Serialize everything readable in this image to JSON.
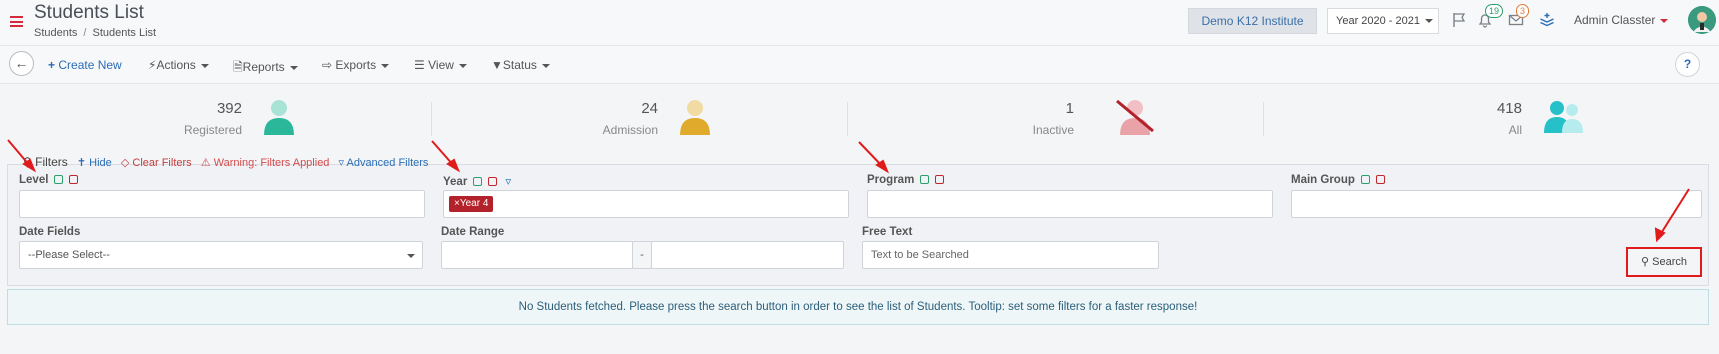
{
  "header": {
    "title": "Students List",
    "breadcrumb": [
      "Students",
      "Students List"
    ],
    "institute": "Demo K12 Institute",
    "year": "Year 2020 - 2021",
    "notifications_count": "19",
    "messages_count": "3",
    "user_name": "Admin Classter"
  },
  "toolbar": {
    "create_new": "Create New",
    "actions": "Actions",
    "reports": "Reports",
    "exports": "Exports",
    "view": "View",
    "status": "Status",
    "help": "?"
  },
  "stats": [
    {
      "value": "392",
      "label": "Registered",
      "color": "#2bb89a"
    },
    {
      "value": "24",
      "label": "Admission",
      "color": "#e0b23a"
    },
    {
      "value": "1",
      "label": "Inactive",
      "color": "#e9a3a8"
    },
    {
      "value": "418",
      "label": "All",
      "color": "#26c0c9"
    }
  ],
  "filters": {
    "title": "Filters",
    "hide": "Hide",
    "clear": "Clear Filters",
    "warning": "Warning: Filters Applied",
    "advanced": "Advanced Filters",
    "level_label": "Level",
    "year_label": "Year",
    "year_tag": "Year 4",
    "program_label": "Program",
    "main_group_label": "Main Group",
    "date_fields_label": "Date Fields",
    "date_fields_value": "--Please Select--",
    "date_range_label": "Date Range",
    "date_range_sep": "-",
    "free_text_label": "Free Text",
    "free_text_placeholder": "Text to be Searched",
    "search_button": "Search"
  },
  "alert": {
    "message": "No Students fetched. Please press the search button in order to see the list of Students. Tooltip: set some filters for a faster response!"
  }
}
